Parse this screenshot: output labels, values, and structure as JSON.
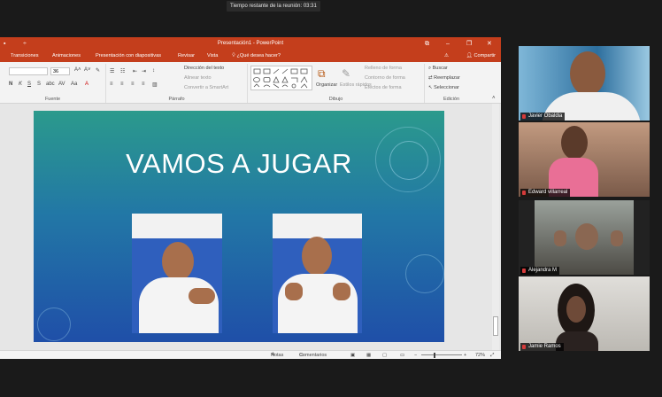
{
  "meeting": {
    "timer": "Tiempo restante de la reunión: 03:31"
  },
  "ppt": {
    "window_title": "Presentación1 - PowerPoint",
    "tabs": [
      "Transiciones",
      "Animaciones",
      "Presentación con diapositivas",
      "Revisar",
      "Vista"
    ],
    "tell_me": "¿Qué desea hacer?",
    "share": "Compartir",
    "font_name": "",
    "font_size": "36",
    "ribbon": {
      "fuente": "Fuente",
      "parrafo": "Párrafo",
      "dibujo": "Dibujo",
      "edicion": "Edición",
      "direccion_texto": "Dirección del texto",
      "alinear_texto": "Alinear texto",
      "convertir_smartart": "Convertir a SmartArt",
      "organizar": "Organizar",
      "estilos_rapidos": "Estilos rápidos",
      "relleno": "Relleno de forma",
      "contorno": "Contorno de forma",
      "efectos": "Efectos de forma",
      "buscar": "Buscar",
      "reemplazar": "Reemplazar",
      "seleccionar": "Seleccionar"
    },
    "slide_title": "VAMOS A JUGAR",
    "status": {
      "notas": "Notas",
      "comentarios": "Comentarios",
      "zoom": "72%"
    }
  },
  "participants": [
    {
      "name": "Javier Obaldia"
    },
    {
      "name": "Edward villarreal"
    },
    {
      "name": "Alejandra M"
    },
    {
      "name": "Jamie Ramos"
    }
  ],
  "colors": {
    "accent": "#c43e1c",
    "mic_muted": "#d43a3a"
  }
}
